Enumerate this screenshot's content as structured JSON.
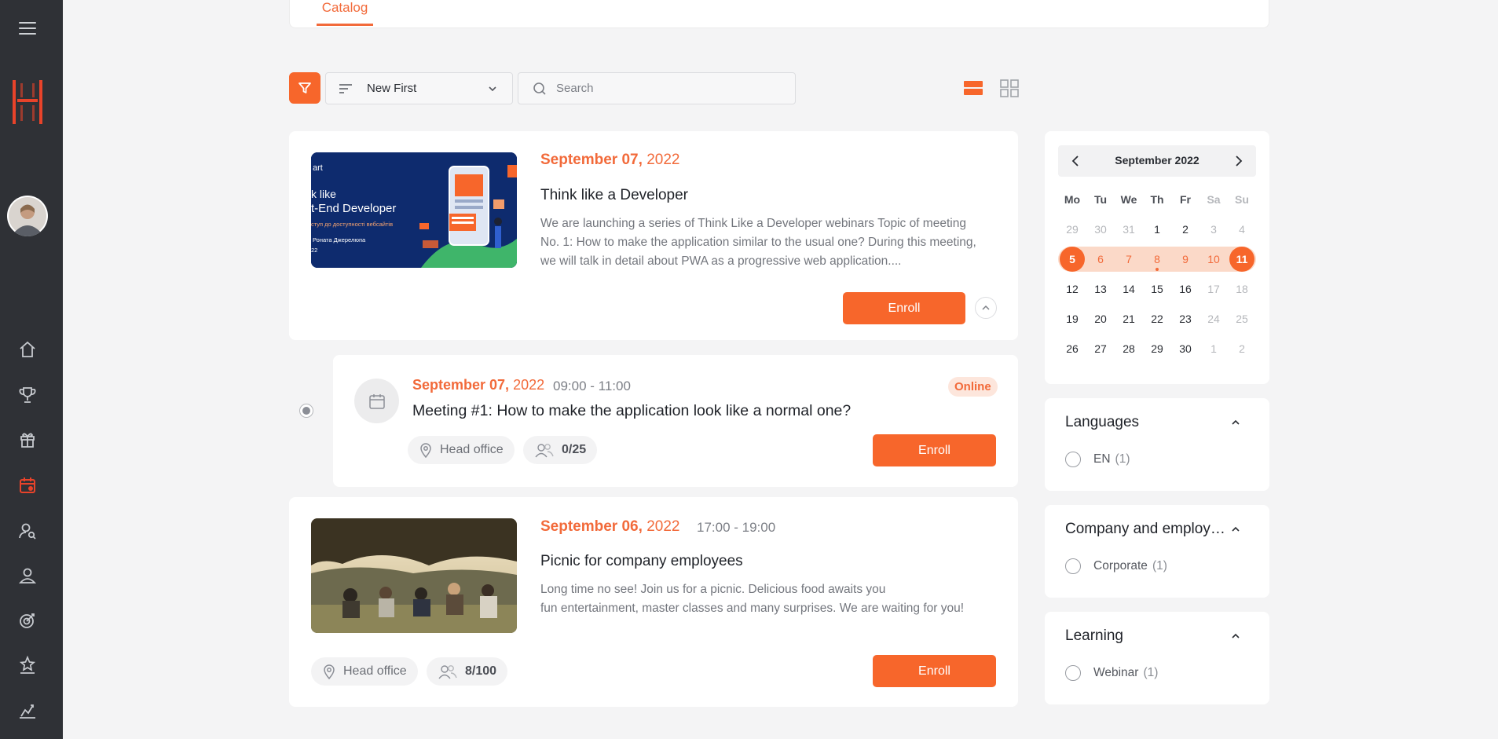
{
  "topbar": {
    "tab_catalog": "Catalog"
  },
  "toolbar": {
    "sort_value": "New First",
    "search_placeholder": "Search"
  },
  "events": [
    {
      "date_bold": "September 07,",
      "year": "2022",
      "title": "Think like a Developer",
      "description": "We are launching a series of Think Like a Developer webinars Topic of meeting No. 1: How to make the application similar to the usual one? During this meeting, we will talk in detail about PWA as a progressive web application....",
      "enroll_label": "Enroll",
      "thumb_text": {
        "line1": "k like",
        "line2": "t-End Developer",
        "line3": "ступ до доступності вебсайтів",
        "line4": "Роната Джерелюпа",
        "line5": "22",
        "corner": "art"
      }
    },
    {
      "date_bold": "September 07,",
      "year": "2022",
      "time": "09:00 - 11:00",
      "title": "Meeting #1: How to make the application look like a normal one?",
      "badge": "Online",
      "location": "Head office",
      "seats": "0/25",
      "enroll_label": "Enroll"
    },
    {
      "date_bold": "September 06,",
      "year": "2022",
      "time": "17:00 - 19:00",
      "title": "Picnic for company employees",
      "description_line1": "Long time no see! Join us for a picnic. Delicious food awaits you",
      "description_line2": "fun entertainment, master classes and many surprises. We are waiting for you!",
      "location": "Head office",
      "seats": "8/100",
      "enroll_label": "Enroll"
    }
  ],
  "calendar": {
    "title": "September 2022",
    "weekdays": [
      "Mo",
      "Tu",
      "We",
      "Th",
      "Fr",
      "Sa",
      "Su"
    ],
    "weeks": [
      [
        "29",
        "30",
        "31",
        "1",
        "2",
        "3",
        "4"
      ],
      [
        "5",
        "6",
        "7",
        "8",
        "9",
        "10",
        "11"
      ],
      [
        "12",
        "13",
        "14",
        "15",
        "16",
        "17",
        "18"
      ],
      [
        "19",
        "20",
        "21",
        "22",
        "23",
        "24",
        "25"
      ],
      [
        "26",
        "27",
        "28",
        "29",
        "30",
        "1",
        "2"
      ]
    ],
    "selected_range": [
      "5",
      "11"
    ],
    "accent_color": "#f7662b"
  },
  "filters": [
    {
      "title": "Languages",
      "option": "EN",
      "count": "(1)"
    },
    {
      "title": "Company and employees",
      "option": "Corporate",
      "count": "(1)"
    },
    {
      "title": "Learning",
      "option": "Webinar",
      "count": "(1)"
    }
  ],
  "sidebar": {
    "icons": [
      "home-icon",
      "trophy-icon",
      "gift-icon",
      "calendar-icon",
      "user-search-icon",
      "user-icon",
      "target-icon",
      "stars-icon",
      "chart-icon"
    ]
  }
}
